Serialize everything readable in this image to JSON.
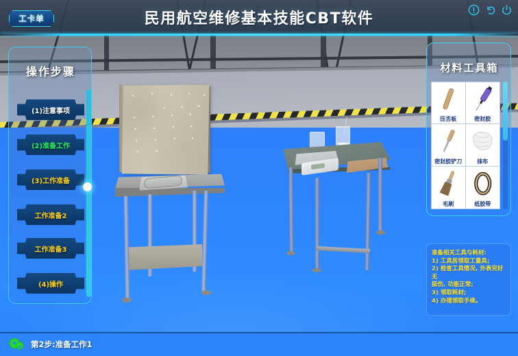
{
  "topbar": {
    "workcard_button": "工卡单",
    "title": "民用航空维修基本技能CBT软件",
    "icons": [
      {
        "name": "info-icon",
        "label": "!"
      },
      {
        "name": "undo-icon",
        "label": "↺"
      },
      {
        "name": "power-icon",
        "label": "⏻"
      }
    ]
  },
  "steps_panel": {
    "title": "操作步骤",
    "items": [
      {
        "label": "(1)注意事项",
        "state": "white"
      },
      {
        "label": "(2)准备工作",
        "state": "green"
      },
      {
        "label": "(3)工作准备",
        "state": "yellow"
      },
      {
        "label": "工作准备2",
        "state": "yellow"
      },
      {
        "label": "工作准备3",
        "state": "yellow"
      },
      {
        "label": "(4)操作",
        "state": "yellow"
      }
    ],
    "active_index": 1
  },
  "toolbox": {
    "title": "材料工具箱",
    "tools": [
      {
        "label": "压舌板",
        "icon": "tongue-depressor-icon"
      },
      {
        "label": "密封胶",
        "icon": "sealant-syringe-icon"
      },
      {
        "label": "密封胶铲刀",
        "icon": "sealant-spatula-icon"
      },
      {
        "label": "抹布",
        "icon": "cloth-rag-icon"
      },
      {
        "label": "毛刷",
        "icon": "paint-brush-icon"
      },
      {
        "label": "纸胶带",
        "icon": "masking-tape-icon"
      }
    ]
  },
  "instructions": {
    "lines": [
      "准备相关工具与耗材:",
      "1)  工具房领取工量具;",
      "2)  检查工具情况, 外表完好无",
      "损伤, 功能正常;",
      "3)  领取耗材;",
      "4)  办理领取手续。"
    ]
  },
  "statusbar": {
    "icon": "gears-icon",
    "text": "第2步:准备工作1"
  },
  "colors": {
    "accent_cyan": "#3fd0f0",
    "floor_blue": "#2f86fd",
    "panel_blue": "#2a7cf5",
    "active_green": "#2bf05a",
    "step_yellow": "#ffd21e"
  }
}
